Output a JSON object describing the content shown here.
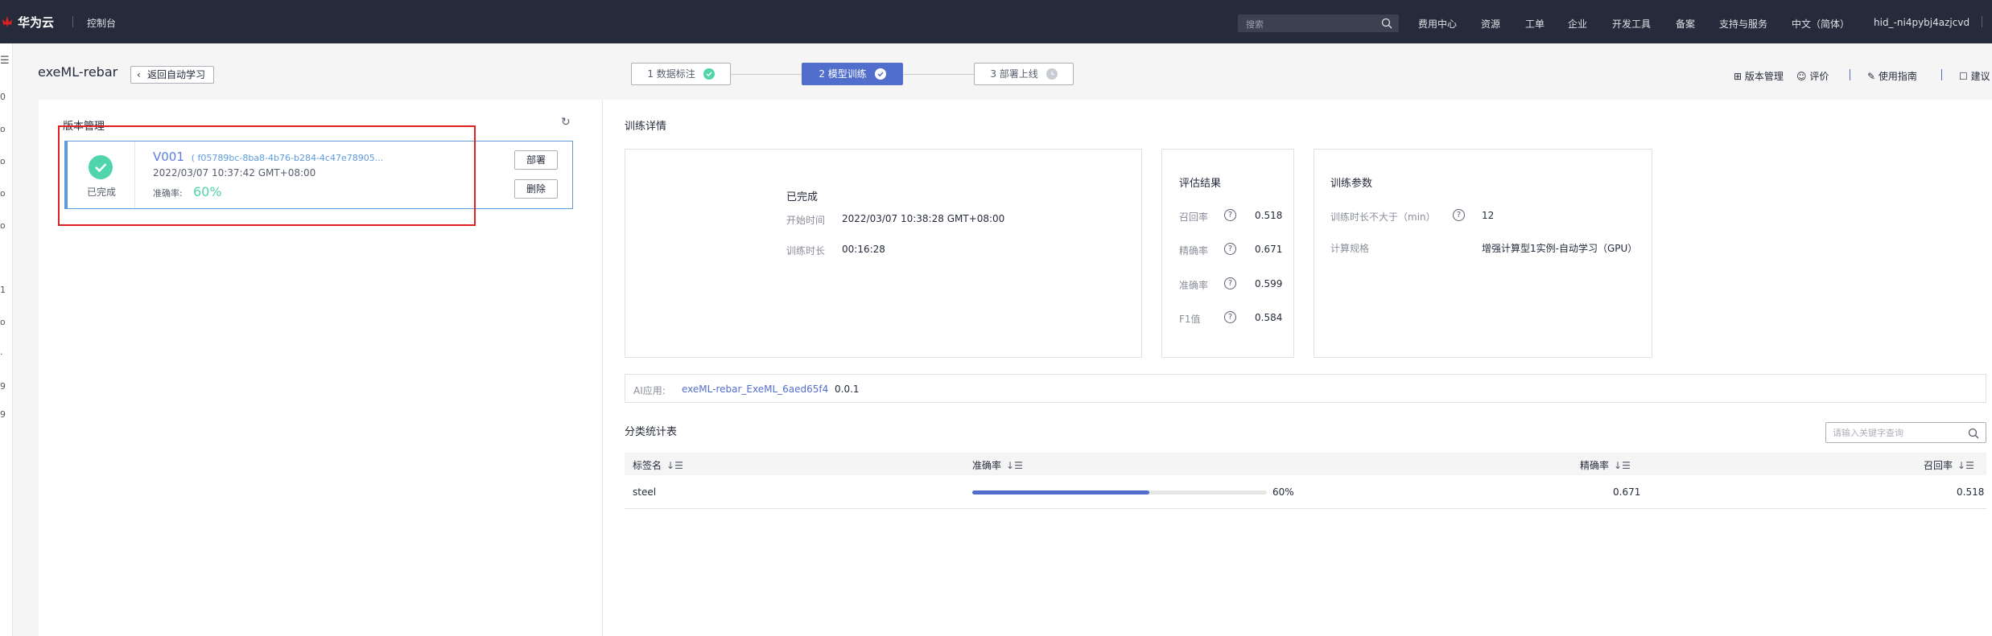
{
  "topbar": {
    "brand": "华为云",
    "console": "控制台",
    "search_placeholder": "搜索",
    "nav": [
      "费用中心",
      "资源",
      "工单",
      "企业",
      "开发工具",
      "备案",
      "支持与服务",
      "中文（简体）",
      "hid_-ni4pybj4azjcvd"
    ]
  },
  "leftrail": {
    "glyphs": [
      "☰",
      "0",
      "o",
      "o",
      "o",
      "o",
      "1",
      "o",
      "·",
      "9",
      "9"
    ]
  },
  "header": {
    "title": "exeML-rebar",
    "back_label": "返回自动学习",
    "steps": [
      {
        "label": "1 数据标注",
        "state": "done"
      },
      {
        "label": "2 模型训练",
        "state": "active"
      },
      {
        "label": "3 部署上线",
        "state": "pending"
      }
    ],
    "right": {
      "version_mgmt": "版本管理",
      "rating": "评价",
      "guide": "使用指南",
      "suggest": "建议"
    }
  },
  "left": {
    "title": "版本管理",
    "card": {
      "status": "已完成",
      "version": "V001",
      "id": "( f05789bc-8ba8-4b76-b284-4c47e78905...",
      "time": "2022/03/07 10:37:42 GMT+08:00",
      "acc_label": "准确率:",
      "acc_value": "60%",
      "deploy_label": "部署",
      "delete_label": "删除"
    }
  },
  "right": {
    "title": "训练详情",
    "status_box": {
      "title": "已完成",
      "start_label": "开始时间",
      "start_value": "2022/03/07 10:38:28 GMT+08:00",
      "duration_label": "训练时长",
      "duration_value": "00:16:28"
    },
    "eval": {
      "title": "评估结果",
      "rows": [
        {
          "label": "召回率",
          "value": "0.518"
        },
        {
          "label": "精确率",
          "value": "0.671"
        },
        {
          "label": "准确率",
          "value": "0.599"
        },
        {
          "label": "F1值",
          "value": "0.584"
        }
      ]
    },
    "params": {
      "title": "训练参数",
      "duration_label": "训练时长不大于（min）",
      "duration_value": "12",
      "spec_label": "计算规格",
      "spec_value": "增强计算型1实例-自动学习（GPU）"
    },
    "ai": {
      "label": "AI应用:",
      "link": "exeML-rebar_ExeML_6aed65f4",
      "version": "0.0.1"
    },
    "stats": {
      "title": "分类统计表",
      "search_placeholder": "请输入关键字查询",
      "headers": [
        "标签名",
        "准确率",
        "精确率",
        "召回率"
      ],
      "sort_icon": "↓☰",
      "rows": [
        {
          "label": "steel",
          "accuracy_text": "60%",
          "accuracy": 0.6,
          "precision": "0.671",
          "recall": "0.518"
        }
      ]
    }
  },
  "colors": {
    "accent": "#526ecc",
    "success": "#50d4ab",
    "highlight": "#e02020",
    "topbar": "#252b3a"
  }
}
